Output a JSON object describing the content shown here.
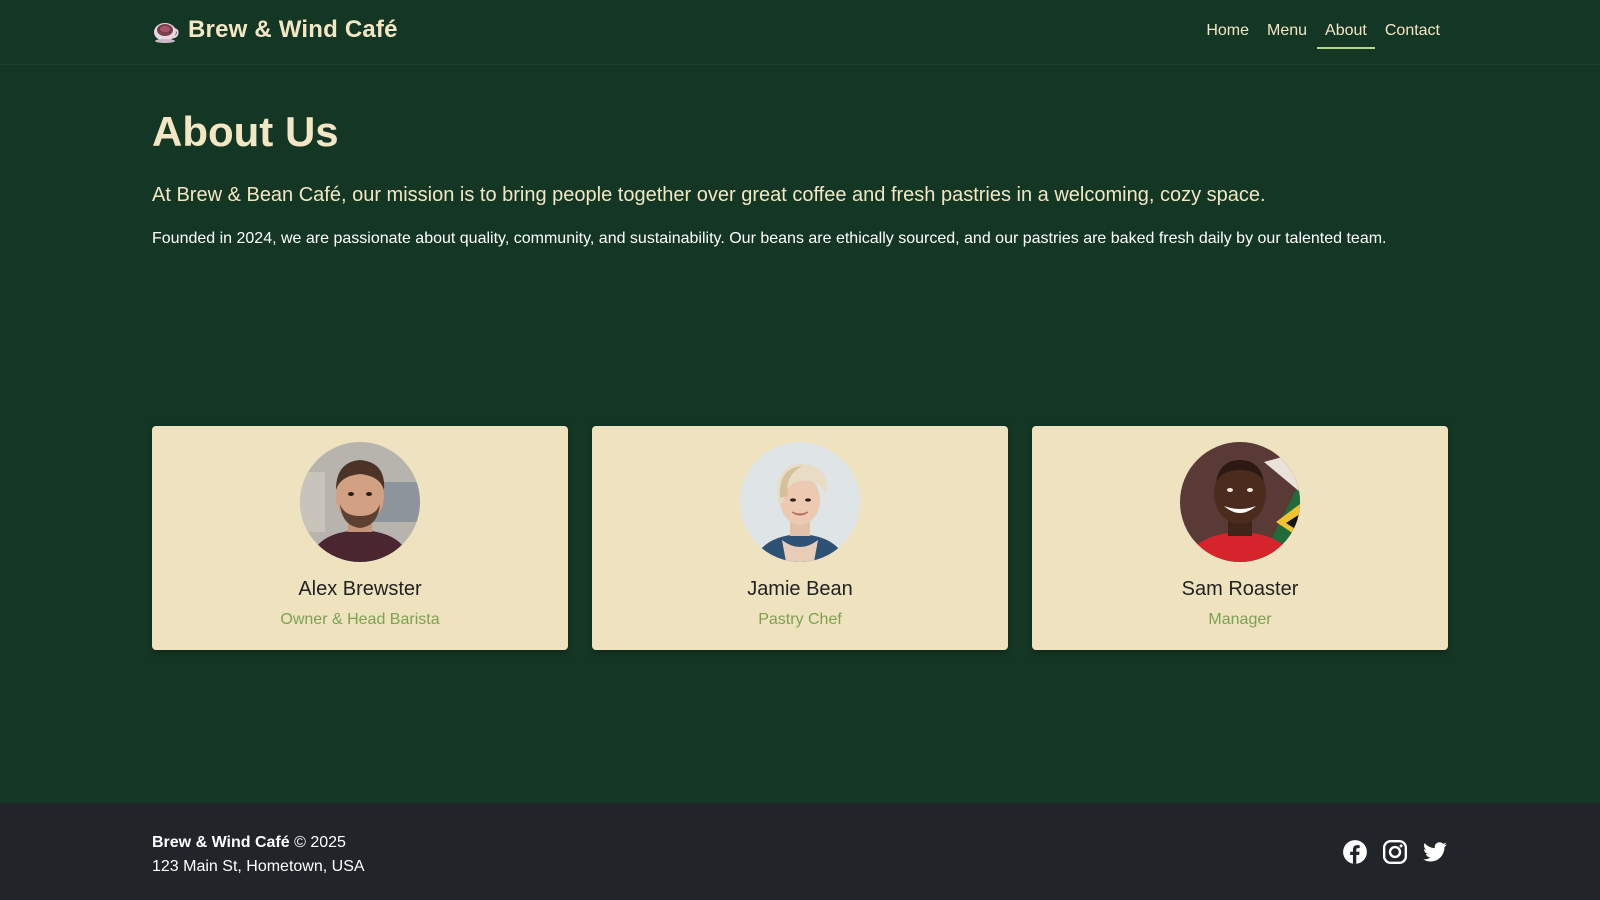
{
  "header": {
    "brand_name": "Brew & Wind Café",
    "brand_icon": "coffee-cup-icon",
    "nav": [
      {
        "label": "Home"
      },
      {
        "label": "Menu"
      },
      {
        "label": "About",
        "active": true
      },
      {
        "label": "Contact"
      }
    ]
  },
  "main": {
    "title": "About Us",
    "lead": "At Brew & Bean Café, our mission is to bring people together over great coffee and fresh pastries in a welcoming, cozy space.",
    "body": "Founded in 2024, we are passionate about quality, community, and sustainability. Our beans are ethically sourced, and our pastries are baked fresh daily by our talented team.",
    "team": [
      {
        "name": "Alex Brewster",
        "role": "Owner & Head Barista"
      },
      {
        "name": "Jamie Bean",
        "role": "Pastry Chef"
      },
      {
        "name": "Sam Roaster",
        "role": "Manager"
      }
    ]
  },
  "footer": {
    "brand": "Brew & Wind Café",
    "copyright": "© 2025",
    "address": "123 Main St, Hometown, USA",
    "social_icons": [
      "facebook-icon",
      "instagram-icon",
      "twitter-icon"
    ]
  },
  "colors": {
    "background": "#143625",
    "text_cream": "#f3e7c3",
    "card_background": "#efe2bf",
    "role_green": "#7da14f",
    "footer_background": "#212529",
    "active_underline": "#b7d98c"
  }
}
